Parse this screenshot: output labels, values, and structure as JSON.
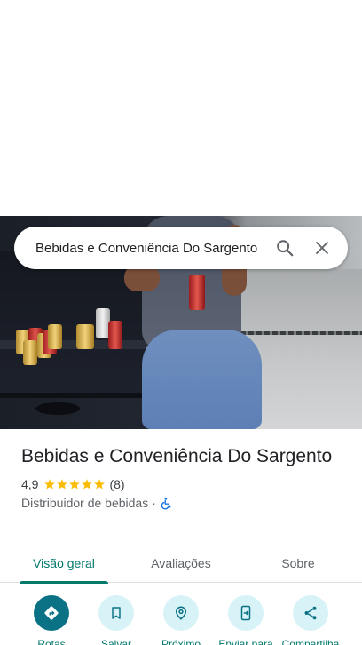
{
  "search": {
    "query": "Bebidas e Conveniência Do Sargento"
  },
  "place": {
    "name": "Bebidas e Conveniência Do Sargento",
    "rating": "4,9",
    "stars": 5,
    "review_count": "(8)",
    "category": "Distribuidor de bebidas",
    "separator": "·"
  },
  "tabs": [
    {
      "label": "Visão geral",
      "active": true
    },
    {
      "label": "Avaliações",
      "active": false
    },
    {
      "label": "Sobre",
      "active": false
    }
  ],
  "actions": [
    {
      "label": "Rotas",
      "icon": "directions-icon"
    },
    {
      "label": "Salvar",
      "icon": "bookmark-icon"
    },
    {
      "label": "Próximo",
      "icon": "nearby-icon"
    },
    {
      "label": "Enviar para",
      "icon": "send-to-phone-icon"
    },
    {
      "label": "Compartilha",
      "icon": "share-icon"
    }
  ],
  "colors": {
    "accent": "#00796b",
    "primary_button": "#0b7285",
    "secondary_button": "#d7f3f7",
    "star": "#fbbc04"
  }
}
